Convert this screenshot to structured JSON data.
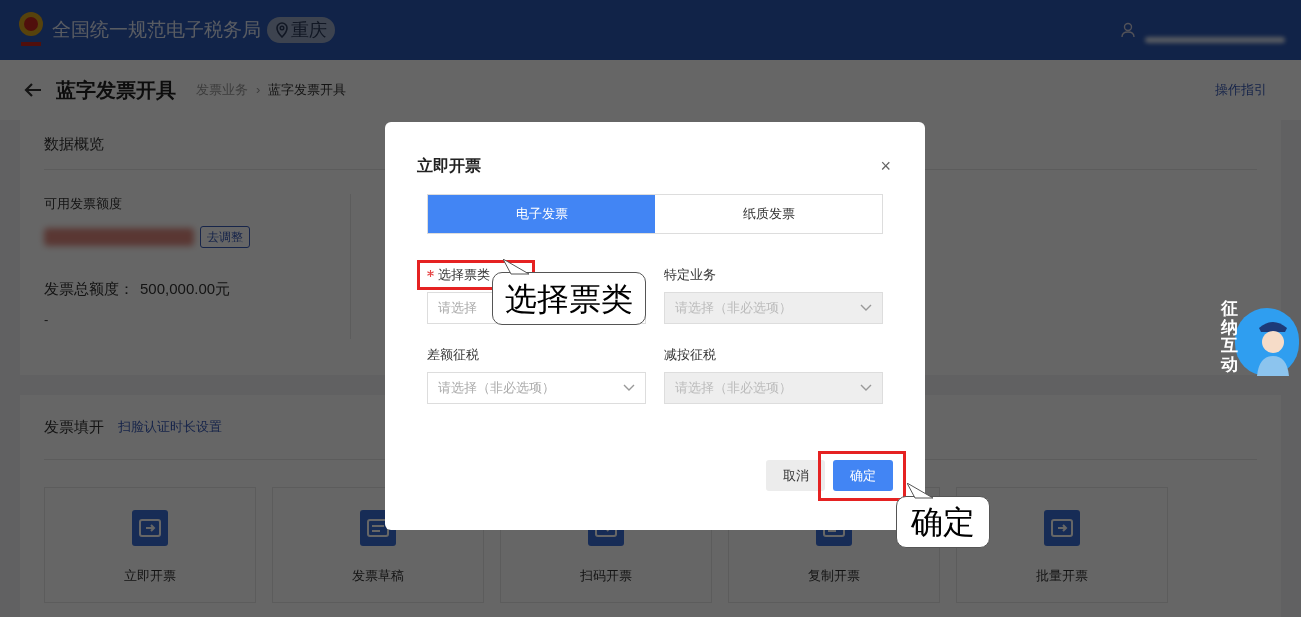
{
  "header": {
    "site_title": "全国统一规范电子税务局",
    "region": "重庆"
  },
  "page": {
    "title": "蓝字发票开具",
    "breadcrumb": [
      "发票业务",
      "蓝字发票开具"
    ],
    "breadcrumb_separator": "›",
    "guide_link": "操作指引"
  },
  "overview": {
    "title": "数据概览",
    "label": "可用发票额度",
    "action": "去调整",
    "total_label": "发票总额度：",
    "total_value": "500,000.00元",
    "note": "-"
  },
  "invoice_fill": {
    "title": "发票填开",
    "settings_link": "扫脸认证时长设置",
    "tiles": [
      {
        "label": "立即开票"
      },
      {
        "label": "发票草稿"
      },
      {
        "label": "扫码开票"
      },
      {
        "label": "复制开票"
      },
      {
        "label": "批量开票"
      }
    ]
  },
  "dialog": {
    "title": "立即开票",
    "close": "×",
    "tabs": [
      {
        "label": "电子发票",
        "selected": true
      },
      {
        "label": "纸质发票",
        "selected": false
      }
    ],
    "fields": [
      {
        "label": "选择票类",
        "required": true,
        "placeholder": "请选择",
        "disabled": false,
        "highlighted": true
      },
      {
        "label": "特定业务",
        "required": false,
        "placeholder": "请选择（非必选项）",
        "disabled": true,
        "highlighted": false
      },
      {
        "label": "差额征税",
        "required": false,
        "placeholder": "请选择（非必选项）",
        "disabled": false,
        "highlighted": false
      },
      {
        "label": "减按征税",
        "required": false,
        "placeholder": "请选择（非必选项）",
        "disabled": true,
        "highlighted": false
      }
    ],
    "buttons": [
      {
        "label": "取消",
        "kind": "secondary",
        "highlighted": false
      },
      {
        "label": "确定",
        "kind": "primary",
        "highlighted": true
      }
    ]
  },
  "callouts": [
    {
      "text": "选择票类"
    },
    {
      "text": "确定"
    }
  ],
  "assistant_badge": {
    "text": "征纳互动"
  }
}
